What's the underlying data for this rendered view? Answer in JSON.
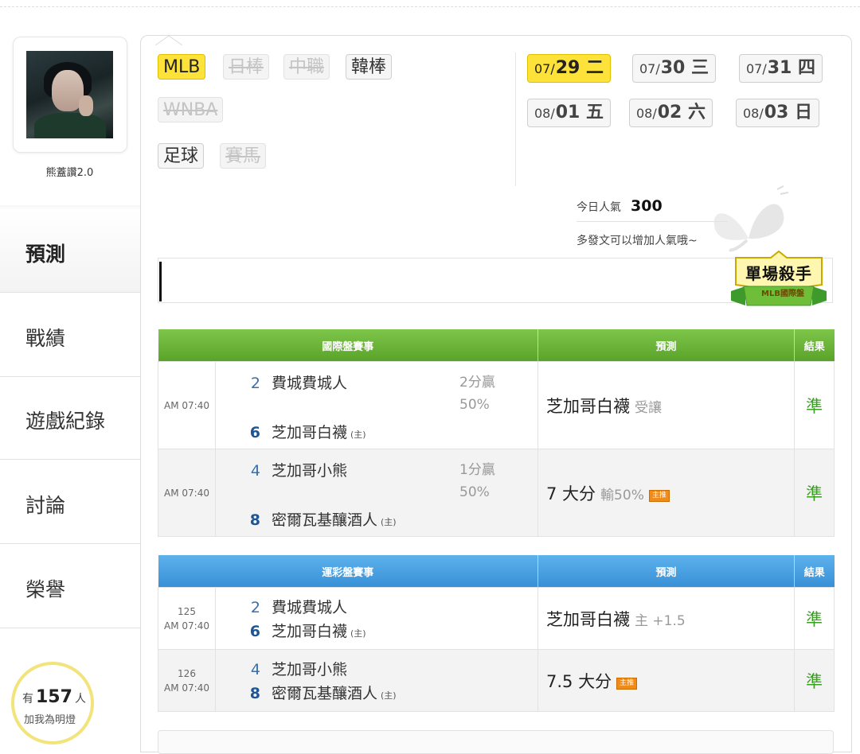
{
  "profile": {
    "nickname": "熊蓋讚2.0"
  },
  "nav": [
    {
      "label": "預測",
      "active": true
    },
    {
      "label": "戰績",
      "active": false
    },
    {
      "label": "遊戲紀錄",
      "active": false
    },
    {
      "label": "討論",
      "active": false
    },
    {
      "label": "榮譽",
      "active": false
    }
  ],
  "fans": {
    "prefix": "有",
    "count": "157",
    "suffix": "人",
    "line2": "加我為明燈"
  },
  "leagues": [
    {
      "label": "MLB",
      "state": "selected"
    },
    {
      "label": "日棒",
      "state": "disabled"
    },
    {
      "label": "中職",
      "state": "disabled"
    },
    {
      "label": "韓棒",
      "state": "normal"
    },
    {
      "label": "WNBA",
      "state": "disabled"
    },
    {
      "label": "足球",
      "state": "normal"
    },
    {
      "label": "賽馬",
      "state": "disabled"
    }
  ],
  "dates": [
    {
      "month": "07/",
      "day": "29 二",
      "selected": true
    },
    {
      "month": "07/",
      "day": "30 三",
      "selected": false
    },
    {
      "month": "07/",
      "day": "31 四",
      "selected": false
    },
    {
      "month": "08/",
      "day": "01 五",
      "selected": false
    },
    {
      "month": "08/",
      "day": "02 六",
      "selected": false
    },
    {
      "month": "08/",
      "day": "03 日",
      "selected": false
    }
  ],
  "popularity": {
    "label": "今日人氣",
    "value": "300",
    "hint": "多發文可以增加人氣哦~"
  },
  "badge": {
    "title": "單場殺手",
    "subtitle": "MLB國際盤"
  },
  "intl_table": {
    "headers": {
      "match": "國際盤賽事",
      "prediction": "預測",
      "result": "結果"
    },
    "rows": [
      {
        "time": "AM 07:40",
        "away_num": "2",
        "away": "費城費城人",
        "home_num": "6",
        "home": "芝加哥白襪",
        "home_mark": "(主)",
        "odds1": "2分贏",
        "odds2": "50%",
        "pick": "芝加哥白襪",
        "pick_note": "受讓",
        "tag": "",
        "result": "準"
      },
      {
        "time": "AM 07:40",
        "away_num": "4",
        "away": "芝加哥小熊",
        "home_num": "8",
        "home": "密爾瓦基釀酒人",
        "home_mark": "(主)",
        "odds1": "1分贏",
        "odds2": "50%",
        "pick": "7 大分",
        "pick_note": "輸50%",
        "tag": "主推",
        "result": "準"
      }
    ]
  },
  "lottery_table": {
    "headers": {
      "match": "運彩盤賽事",
      "prediction": "預測",
      "result": "結果"
    },
    "rows": [
      {
        "game_no": "125",
        "time": "AM 07:40",
        "away_num": "2",
        "away": "費城費城人",
        "home_num": "6",
        "home": "芝加哥白襪",
        "home_mark": "(主)",
        "pick": "芝加哥白襪",
        "pick_note": "主 +1.5",
        "tag": "",
        "result": "準"
      },
      {
        "game_no": "126",
        "time": "AM 07:40",
        "away_num": "4",
        "away": "芝加哥小熊",
        "home_num": "8",
        "home": "密爾瓦基釀酒人",
        "home_mark": "(主)",
        "pick": "7.5 大分",
        "pick_note": "",
        "tag": "主推",
        "result": "準"
      }
    ]
  },
  "colors": {
    "selected": "#fde23a",
    "green_header": "#6ab437",
    "blue_header": "#4aa2e2",
    "result": "#3aa022",
    "tag": "#f08a18",
    "fan_ring": "#f2e47a"
  }
}
